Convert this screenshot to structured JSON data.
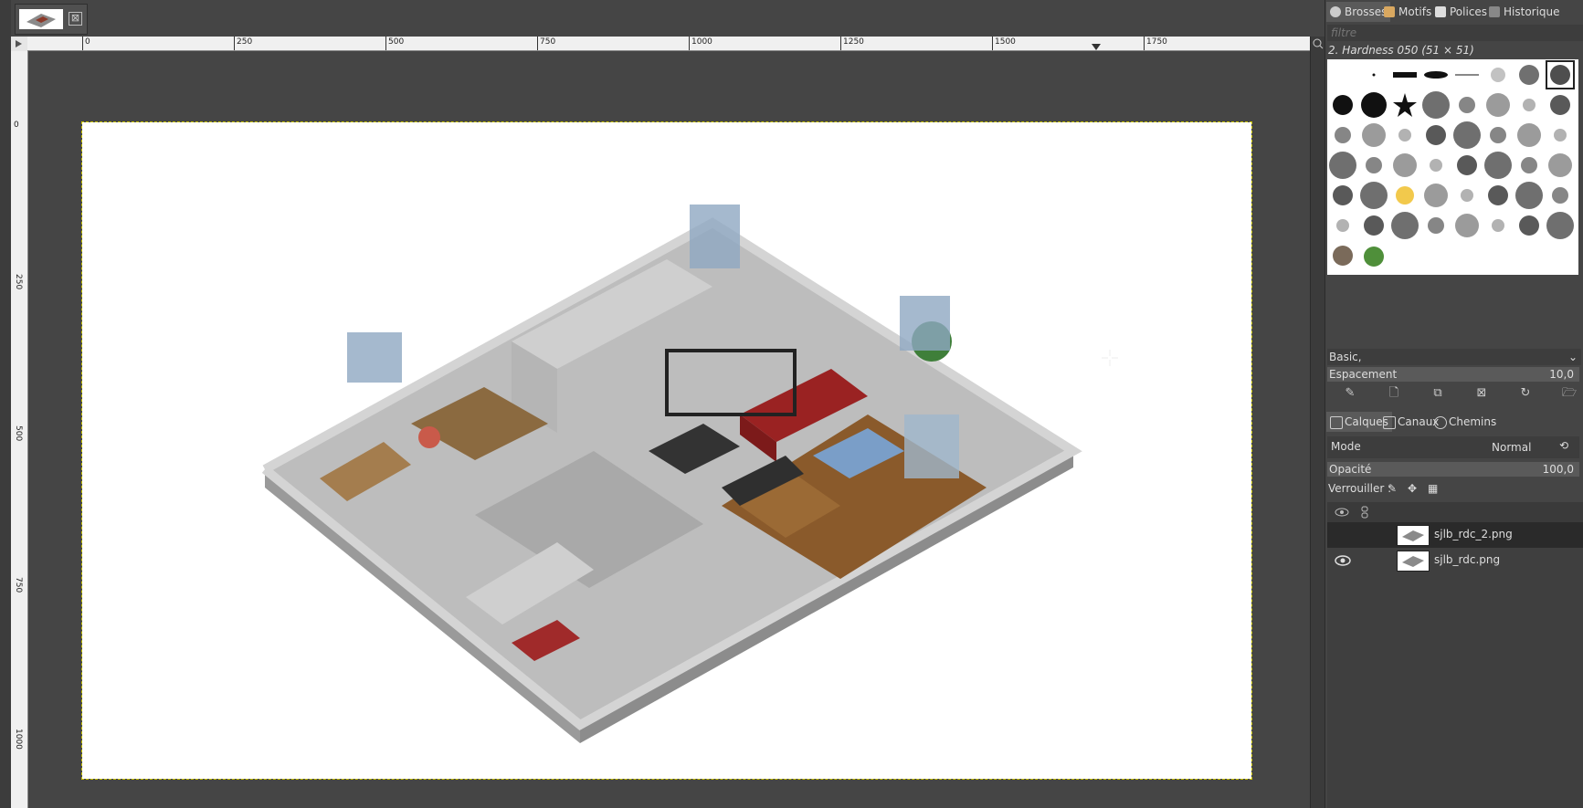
{
  "image_tab": {
    "close_glyph": "⊠"
  },
  "ruler_top_labels": [
    "0",
    "250",
    "500",
    "750",
    "1000",
    "1250",
    "1500",
    "1750"
  ],
  "ruler_left_labels": [
    "0",
    "250",
    "500",
    "750",
    "1000"
  ],
  "dock": {
    "tabs": [
      {
        "label": "Brosses",
        "icon": "brush-icon",
        "color": "#cccccc",
        "active": true
      },
      {
        "label": "Motifs",
        "icon": "pattern-icon",
        "color": "#d9a860",
        "active": false
      },
      {
        "label": "Polices",
        "icon": "font-icon",
        "color": "#dddddd",
        "active": false
      },
      {
        "label": "Historique",
        "icon": "history-icon",
        "color": "#aaaaaa",
        "active": false
      }
    ],
    "filter_placeholder": "filtre",
    "brush_name": "2. Hardness 050 (51 × 51)",
    "preset": "Basic,",
    "spacing_label": "Espacement",
    "spacing_value": "10,0"
  },
  "layers_panel": {
    "tabs": [
      {
        "label": "Calques",
        "icon": "layers-icon"
      },
      {
        "label": "Canaux",
        "icon": "channels-icon"
      },
      {
        "label": "Chemins",
        "icon": "paths-icon"
      }
    ],
    "mode_label": "Mode",
    "mode_value": "Normal",
    "opacity_label": "Opacité",
    "opacity_value": "100,0",
    "lock_label": "Verrouiller :",
    "layers": [
      {
        "name": "sjlb_rdc_2.png",
        "visible": false
      },
      {
        "name": "sjlb_rdc.png",
        "visible": true
      }
    ]
  },
  "colors": {
    "background": "#454545",
    "canvas_white": "#ffffff",
    "selection_marching": "#c8c200"
  }
}
